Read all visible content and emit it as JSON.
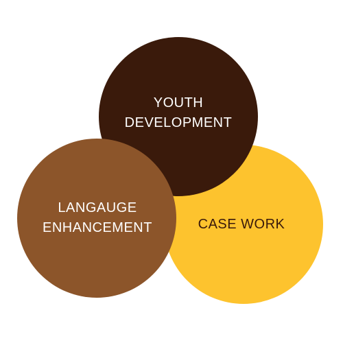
{
  "diagram": {
    "circles": [
      {
        "id": "youth",
        "lines": [
          "YOUTH",
          "DEVELOPMENT"
        ],
        "fill": "#3a1a0b",
        "text_color": "#ffffff"
      },
      {
        "id": "case",
        "lines": [
          "CASE WORK"
        ],
        "fill": "#fdc32e",
        "text_color": "#3a1a0b"
      },
      {
        "id": "language",
        "lines": [
          "LANGAUGE",
          "ENHANCEMENT"
        ],
        "fill": "#8c552a",
        "text_color": "#ffffff"
      }
    ]
  }
}
